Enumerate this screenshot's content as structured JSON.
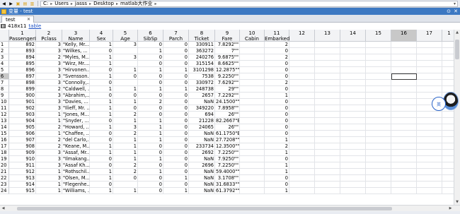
{
  "toolbar": {
    "breadcrumb": [
      "C:",
      "Users",
      "jasss",
      "Desktop",
      "matlab大作业"
    ]
  },
  "titlebar": {
    "title": "变量 - test"
  },
  "tab": {
    "label": "test"
  },
  "info": {
    "size": "418x11",
    "type_link": "table"
  },
  "float_button": {
    "label": "英"
  },
  "columns": [
    {
      "num": "1",
      "name": "PassengerId"
    },
    {
      "num": "2",
      "name": "Pclass"
    },
    {
      "num": "3",
      "name": "Name"
    },
    {
      "num": "4",
      "name": "Sex"
    },
    {
      "num": "5",
      "name": "Age"
    },
    {
      "num": "6",
      "name": "SibSp"
    },
    {
      "num": "7",
      "name": "Parch"
    },
    {
      "num": "8",
      "name": "Ticket"
    },
    {
      "num": "9",
      "name": "Fare"
    },
    {
      "num": "10",
      "name": "Cabin"
    },
    {
      "num": "11",
      "name": "Embarked"
    },
    {
      "num": "12",
      "name": ""
    },
    {
      "num": "13",
      "name": ""
    },
    {
      "num": "14",
      "name": ""
    },
    {
      "num": "15",
      "name": ""
    },
    {
      "num": "16",
      "name": ""
    },
    {
      "num": "17",
      "name": ""
    },
    {
      "num": "1",
      "name": ""
    }
  ],
  "rows": [
    [
      "1",
      "892",
      "3",
      "\"Kelly, Mr....",
      "1",
      "3",
      "0",
      "0",
      "330911",
      "7.8292\"\"",
      "",
      "2"
    ],
    [
      "2",
      "893",
      "3",
      "\"Wilkes, ...",
      "0",
      "",
      "1",
      "0",
      "363272",
      "7\"\"",
      "",
      "0"
    ],
    [
      "3",
      "894",
      "2",
      "\"Myles, M...",
      "1",
      "3",
      "0",
      "0",
      "240276",
      "9.6875\"\"",
      "",
      "2"
    ],
    [
      "4",
      "895",
      "3",
      "\"Wirz, Mr....",
      "1",
      "",
      "0",
      "0",
      "315154",
      "8.6625\"\"",
      "",
      "0"
    ],
    [
      "5",
      "896",
      "3",
      "\"Hirvonen...",
      "0",
      "1",
      "1",
      "1",
      "3101298",
      "12.2875\"\"",
      "",
      "0"
    ],
    [
      "6",
      "897",
      "3",
      "\"Svensson...",
      "1",
      "0",
      "0",
      "0",
      "7538",
      "9.2250\"\"",
      "",
      "0"
    ],
    [
      "7",
      "898",
      "3",
      "\"Connolly,...",
      "0",
      "",
      "0",
      "0",
      "330972",
      "7.6292\"\"",
      "",
      "2"
    ],
    [
      "8",
      "899",
      "2",
      "\"Caldwell, ...",
      "1",
      "1",
      "1",
      "1",
      "248738",
      "29\"\"",
      "",
      "0"
    ],
    [
      "9",
      "900",
      "3",
      "\"Abrahim,...",
      "0",
      "0",
      "0",
      "0",
      "2657",
      "7.2292\"\"",
      "",
      "1"
    ],
    [
      "10",
      "901",
      "3",
      "\"Davies, ...",
      "1",
      "1",
      "2",
      "0",
      "NaN",
      "24.1500\"\"",
      "",
      "0"
    ],
    [
      "11",
      "902",
      "3",
      "\"Ilieff, Mr. ...",
      "1",
      "0",
      "0",
      "0",
      "349220",
      "7.8958\"\"",
      "",
      "0"
    ],
    [
      "12",
      "903",
      "1",
      "\"Jones, M...",
      "1",
      "2",
      "0",
      "0",
      "694",
      "26\"\"",
      "",
      "0"
    ],
    [
      "13",
      "904",
      "1",
      "\"Snyder, ...",
      "0",
      "1",
      "1",
      "0",
      "21228",
      "82.2667\"B45\"",
      "",
      "0"
    ],
    [
      "14",
      "905",
      "2",
      "\"Howard, ...",
      "1",
      "3",
      "1",
      "0",
      "24065",
      "26\"\"",
      "",
      "0"
    ],
    [
      "15",
      "906",
      "1",
      "\"Chaffee, ...",
      "0",
      "2",
      "1",
      "0",
      "NaN",
      "61.1750\"E31\"",
      "",
      "0"
    ],
    [
      "16",
      "907",
      "2",
      "\"del Carlo,...",
      "0",
      "1",
      "1",
      "0",
      "NaN",
      "27.7208\"\"",
      "",
      "1"
    ],
    [
      "17",
      "908",
      "2",
      "\"Keane, M...",
      "1",
      "1",
      "0",
      "0",
      "233734",
      "12.3500\"\"",
      "",
      "2"
    ],
    [
      "18",
      "909",
      "3",
      "\"Assaf, Mr...",
      "1",
      "1",
      "0",
      "0",
      "2692",
      "7.2250\"\"",
      "",
      "1"
    ],
    [
      "19",
      "910",
      "3",
      "\"Ilmakang...",
      "0",
      "1",
      "1",
      "0",
      "NaN",
      "7.9250\"\"",
      "",
      "0"
    ],
    [
      "20",
      "911",
      "3",
      "\"Assaf Kh...",
      "0",
      "2",
      "0",
      "0",
      "2696",
      "7.2250\"\"",
      "",
      "1"
    ],
    [
      "21",
      "912",
      "1",
      "\"Rothschil...",
      "1",
      "2",
      "1",
      "0",
      "NaN",
      "59.4000\"\"",
      "",
      "1"
    ],
    [
      "22",
      "913",
      "3",
      "\"Olsen, M...",
      "1",
      "0",
      "0",
      "1",
      "NaN",
      "3.1708\"\"",
      "",
      "0"
    ],
    [
      "23",
      "914",
      "1",
      "\"Flegenhe...",
      "0",
      "",
      "0",
      "0",
      "NaN",
      "31.6833\"\"",
      "",
      "0"
    ],
    [
      "24",
      "915",
      "1",
      "\"Williams, ...",
      "1",
      "1",
      "0",
      "1",
      "NaN",
      "61.3792\"\"",
      "",
      "1"
    ]
  ]
}
